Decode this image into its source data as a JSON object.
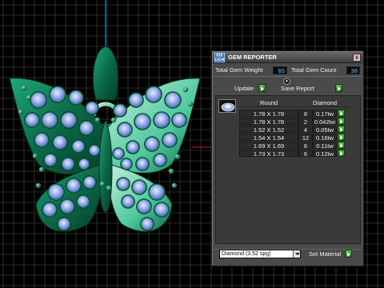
{
  "viewport": {
    "background_color": "#000000",
    "grid_color": "#4d4d4d",
    "model": "butterfly-pendant",
    "metal_color": "#0d7a55",
    "gem_color": "#a8b8f2"
  },
  "panel": {
    "title": "GEM REPORTER",
    "icon_text": "RHI GEM",
    "close_label": "x",
    "total_weight_label": "Total Gem Weight",
    "total_weight_value": "65",
    "total_count_label": "Total Gem Count",
    "total_count_value": "38",
    "update_label": "Update",
    "save_report_label": "Save Report",
    "table": {
      "headers": [
        "Round",
        "Diamond"
      ],
      "rows": [
        {
          "size": "1.78 X 1.78",
          "count": "8",
          "weight": "0.17tw"
        },
        {
          "size": "1.78 X 1.78",
          "count": "2",
          "weight": "0.042tw"
        },
        {
          "size": "1.52 X 1.52",
          "count": "4",
          "weight": "0.05tw"
        },
        {
          "size": "1.54 X 1.54",
          "count": "12",
          "weight": "0.16tw"
        },
        {
          "size": "1.69 X 1.69",
          "count": "6",
          "weight": "0.11tw"
        },
        {
          "size": "1.73 X 1.73",
          "count": "6",
          "weight": "0.12tw"
        }
      ]
    },
    "material_value": "Diamond    (3.52 spg)",
    "set_material_label": "Set Material"
  }
}
